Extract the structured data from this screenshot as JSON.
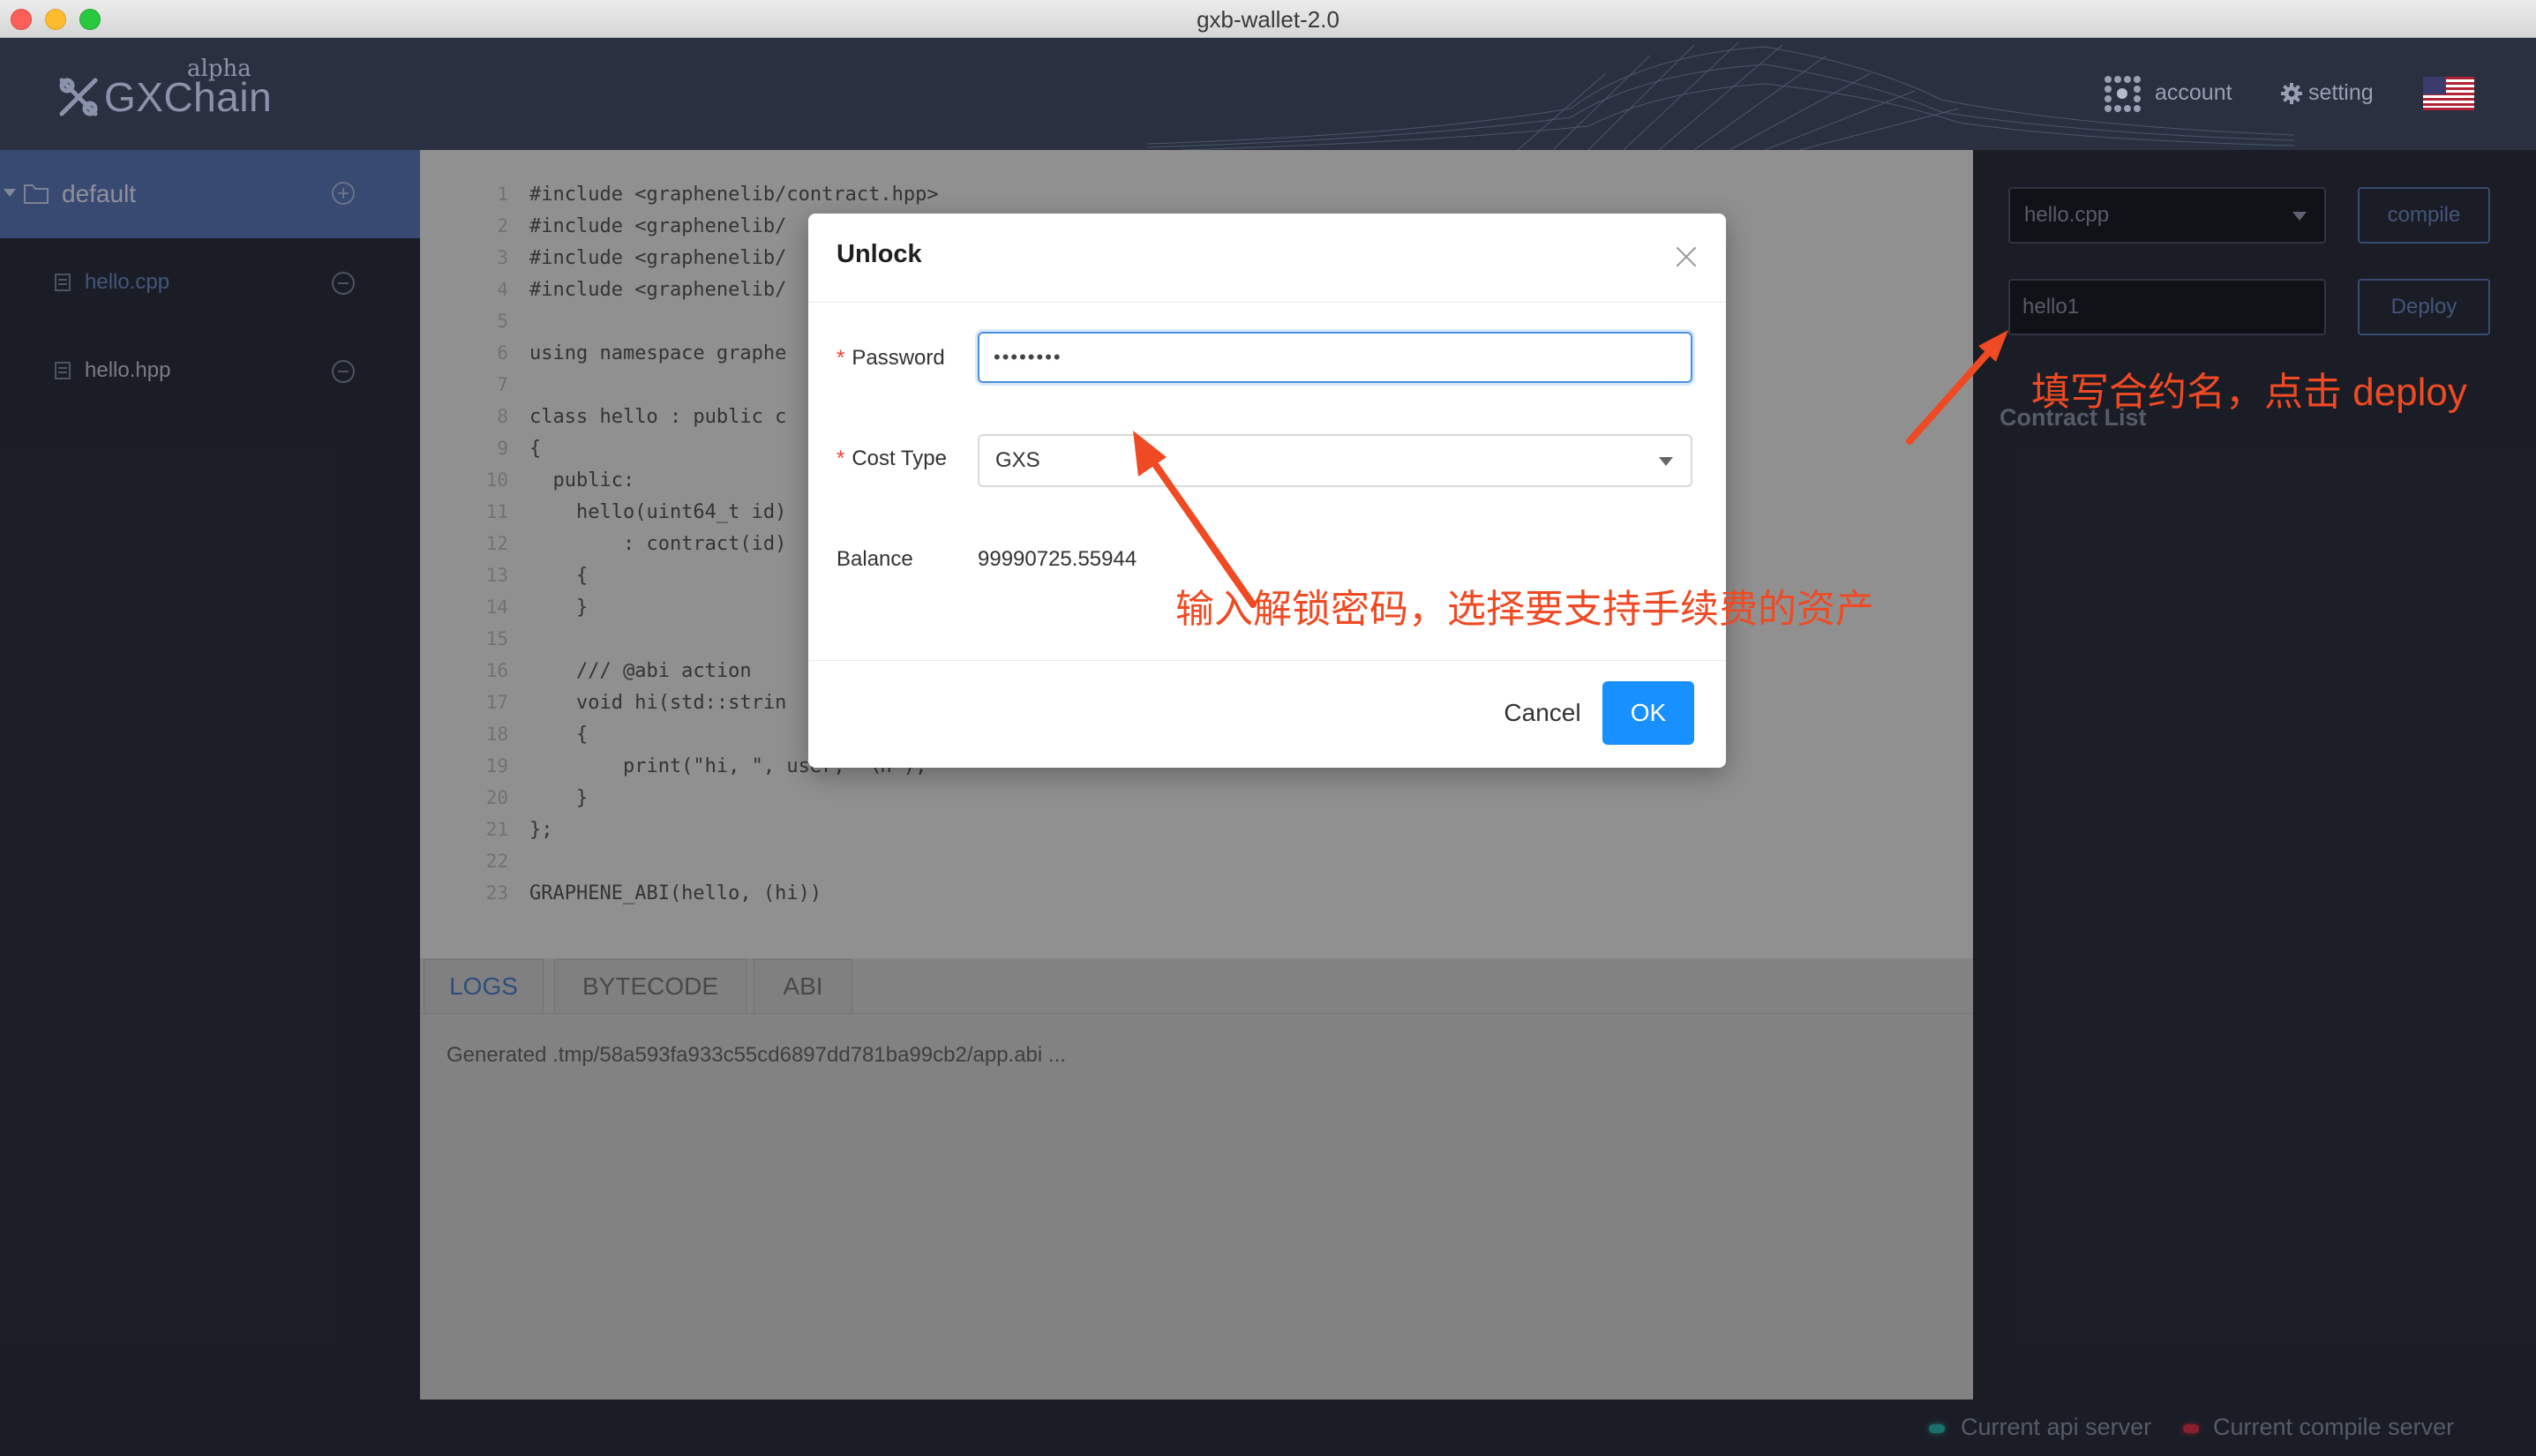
{
  "window": {
    "title": "gxb-wallet-2.0"
  },
  "header": {
    "logo_text": "GXChain",
    "logo_badge": "alpha",
    "account_label": "account",
    "setting_label": "setting",
    "flag": "us-flag-icon"
  },
  "sidebar": {
    "folder": "default",
    "files": [
      {
        "name": "hello.cpp",
        "active": true
      },
      {
        "name": "hello.hpp",
        "active": false
      }
    ]
  },
  "editor": {
    "line_numbers": [
      "1",
      "2",
      "3",
      "4",
      "5",
      "6",
      "7",
      "8",
      "9",
      "10",
      "11",
      "12",
      "13",
      "14",
      "15",
      "16",
      "17",
      "18",
      "19",
      "20",
      "21",
      "22",
      "23"
    ],
    "lines": [
      "#include <graphenelib/contract.hpp>",
      "#include <graphenelib/",
      "#include <graphenelib/",
      "#include <graphenelib/",
      "",
      "using namespace graphe",
      "",
      "class hello : public c",
      "{",
      "  public:",
      "    hello(uint64_t id)",
      "        : contract(id)",
      "    {",
      "    }",
      "",
      "    /// @abi action",
      "    void hi(std::strin",
      "    {",
      "        print(\"hi, \", user, \"\\n\");",
      "    }",
      "};",
      "",
      "GRAPHENE_ABI(hello, (hi))"
    ]
  },
  "bottom_tabs": [
    "LOGS",
    "BYTECODE",
    "ABI"
  ],
  "log_text": "Generated .tmp/58a593fa933c55cd6897dd781ba99cb2/app.abi ...",
  "right_panel": {
    "file_select": "hello.cpp",
    "compile_label": "compile",
    "contract_name": "hello1",
    "deploy_label": "Deploy",
    "contract_list_title": "Contract List"
  },
  "status_bar": {
    "api_server": "Current api server",
    "compile_server": "Current compile server",
    "api_color": "#2bb5b0",
    "compile_color": "#e0334d"
  },
  "modal": {
    "title": "Unlock",
    "password_label": "Password",
    "password_value": "••••••••",
    "cost_type_label": "Cost Type",
    "cost_type_value": "GXS",
    "balance_label": "Balance",
    "balance_value": "99990725.55944",
    "cancel_label": "Cancel",
    "ok_label": "OK",
    "required_mark": "*"
  },
  "annotations": {
    "deploy_hint": "填写合约名，点击 deploy",
    "unlock_hint": "输入解锁密码，选择要支持手续费的资产",
    "color": "#ef4a23"
  }
}
